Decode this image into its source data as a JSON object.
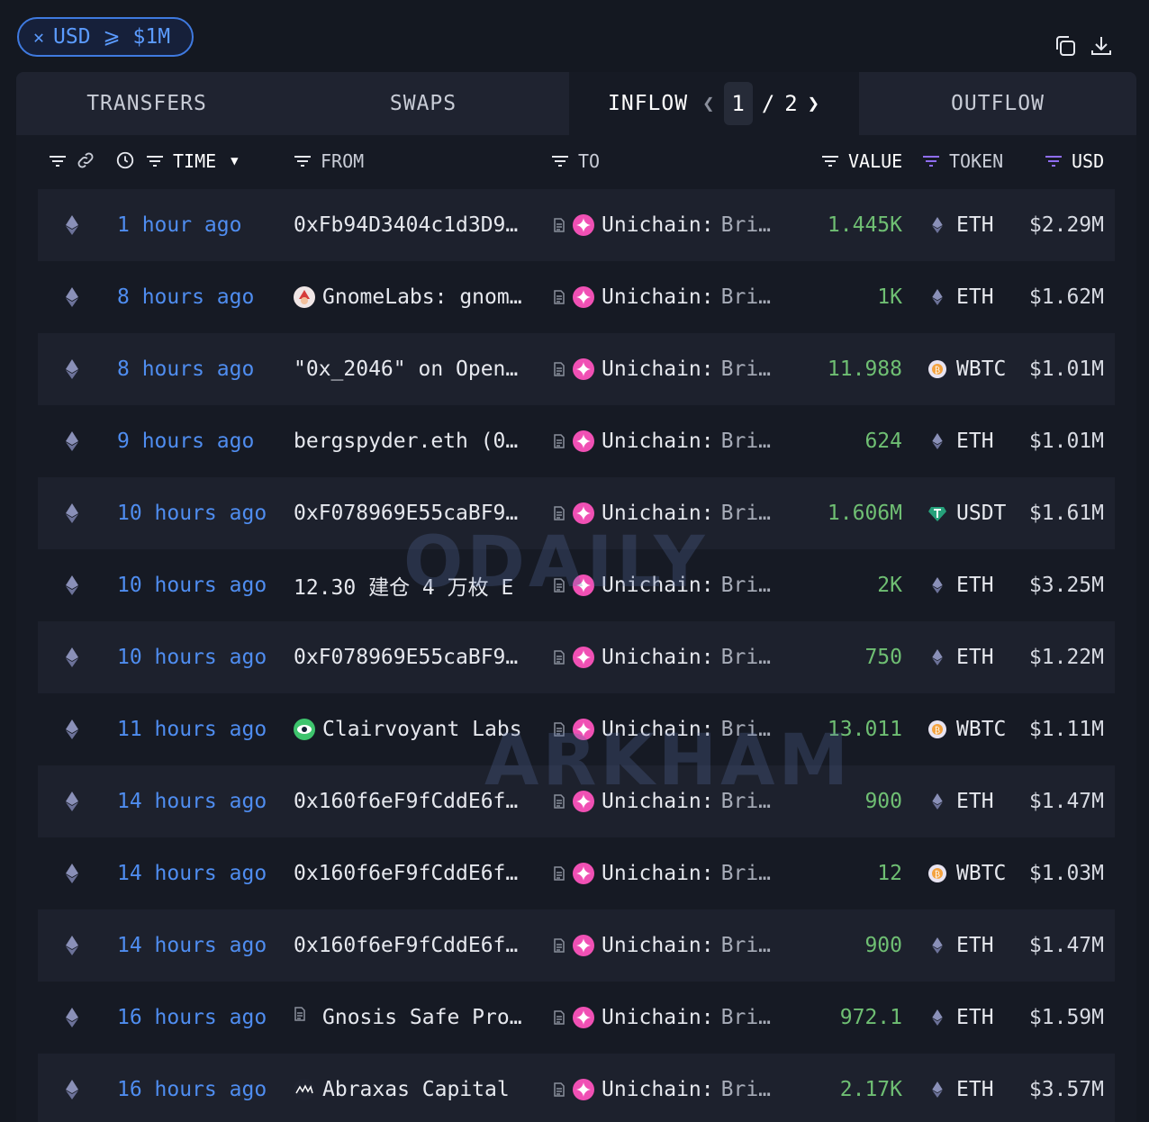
{
  "filter": {
    "close_icon": "close-icon",
    "label": "USD ⩾ $1M"
  },
  "toolbar": {
    "copy_icon": "copy-icon",
    "download_icon": "download-icon"
  },
  "tabs": [
    {
      "label": "TRANSFERS"
    },
    {
      "label": "SWAPS"
    },
    {
      "label": "INFLOW",
      "active": true
    },
    {
      "label": "OUTFLOW"
    }
  ],
  "pager": {
    "current": "1",
    "separator": "/",
    "total": "2"
  },
  "columns": {
    "time": "TIME",
    "from": "FROM",
    "to": "TO",
    "value": "VALUE",
    "token": "TOKEN",
    "usd": "USD"
  },
  "watermarks": {
    "odaily": "ODAILY",
    "arkham": "ARKHAM"
  },
  "colors": {
    "accent": "#4f8df0",
    "value_green": "#6fbf73",
    "unichain_pink": "#f050b4"
  },
  "rows": [
    {
      "time": "1 hour ago",
      "from": "0xFb94D3404c1d3D9…",
      "from_icon": "none",
      "to_name": "Unichain:",
      "to_rest": "Bri…",
      "value": "1.445K",
      "token": "ETH",
      "usd": "$2.29M"
    },
    {
      "time": "8 hours ago",
      "from": "GnomeLabs: gnom…",
      "from_icon": "gnome-avatar-icon",
      "to_name": "Unichain:",
      "to_rest": "Bri…",
      "value": "1K",
      "token": "ETH",
      "usd": "$1.62M"
    },
    {
      "time": "8 hours ago",
      "from": "\"0x_2046\" on Open…",
      "from_icon": "none",
      "to_name": "Unichain:",
      "to_rest": "Bri…",
      "value": "11.988",
      "token": "WBTC",
      "usd": "$1.01M"
    },
    {
      "time": "9 hours ago",
      "from": "bergspyder.eth (0…",
      "from_icon": "none",
      "to_name": "Unichain:",
      "to_rest": "Bri…",
      "value": "624",
      "token": "ETH",
      "usd": "$1.01M"
    },
    {
      "time": "10 hours ago",
      "from": "0xF078969E55caBF9…",
      "from_icon": "none",
      "to_name": "Unichain:",
      "to_rest": "Bri…",
      "value": "1.606M",
      "token": "USDT",
      "usd": "$1.61M"
    },
    {
      "time": "10 hours ago",
      "from": "12.30 建仓 4 万枚 E",
      "from_icon": "none",
      "to_name": "Unichain:",
      "to_rest": "Bri…",
      "value": "2K",
      "token": "ETH",
      "usd": "$3.25M"
    },
    {
      "time": "10 hours ago",
      "from": "0xF078969E55caBF9…",
      "from_icon": "none",
      "to_name": "Unichain:",
      "to_rest": "Bri…",
      "value": "750",
      "token": "ETH",
      "usd": "$1.22M"
    },
    {
      "time": "11 hours ago",
      "from": "Clairvoyant Labs",
      "from_icon": "clairvoyant-eye-icon",
      "to_name": "Unichain:",
      "to_rest": "Bri…",
      "value": "13.011",
      "token": "WBTC",
      "usd": "$1.11M"
    },
    {
      "time": "14 hours ago",
      "from": "0x160f6eF9fCddE6f…",
      "from_icon": "none",
      "to_name": "Unichain:",
      "to_rest": "Bri…",
      "value": "900",
      "token": "ETH",
      "usd": "$1.47M"
    },
    {
      "time": "14 hours ago",
      "from": "0x160f6eF9fCddE6f…",
      "from_icon": "none",
      "to_name": "Unichain:",
      "to_rest": "Bri…",
      "value": "12",
      "token": "WBTC",
      "usd": "$1.03M"
    },
    {
      "time": "14 hours ago",
      "from": "0x160f6eF9fCddE6f…",
      "from_icon": "none",
      "to_name": "Unichain:",
      "to_rest": "Bri…",
      "value": "900",
      "token": "ETH",
      "usd": "$1.47M"
    },
    {
      "time": "16 hours ago",
      "from": "Gnosis Safe Pro…",
      "from_icon": "contract-doc-icon",
      "to_name": "Unichain:",
      "to_rest": "Bri…",
      "value": "972.1",
      "token": "ETH",
      "usd": "$1.59M"
    },
    {
      "time": "16 hours ago",
      "from": "Abraxas Capital",
      "from_icon": "abraxas-logo-icon",
      "to_name": "Unichain:",
      "to_rest": "Bri…",
      "value": "2.17K",
      "token": "ETH",
      "usd": "$3.57M"
    }
  ]
}
